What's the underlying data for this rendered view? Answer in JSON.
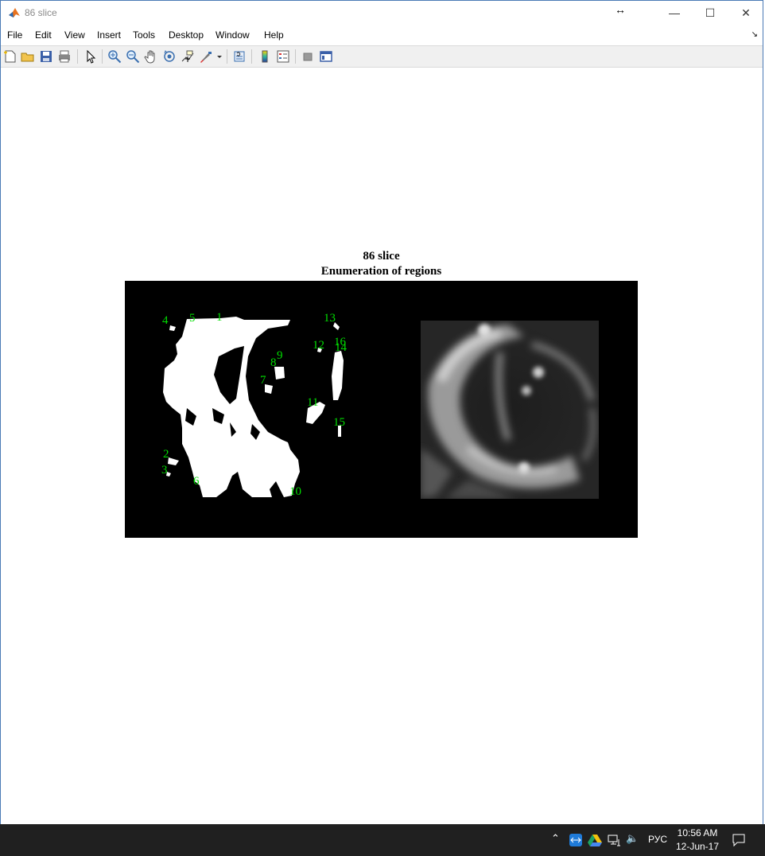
{
  "window": {
    "title": "86 slice",
    "controls": {
      "minimize": "—",
      "maximize": "☐",
      "close": "✕"
    }
  },
  "menu": [
    "File",
    "Edit",
    "View",
    "Insert",
    "Tools",
    "Desktop",
    "Window",
    "Help"
  ],
  "toolbar": {
    "icons": [
      "new-figure-icon",
      "open-file-icon",
      "save-icon",
      "print-icon",
      "select-arrow-icon",
      "zoom-in-icon",
      "zoom-out-icon",
      "pan-hand-icon",
      "rotate-3d-icon",
      "data-cursor-icon",
      "brush-icon",
      "link-plot-icon",
      "colorbar-icon",
      "legend-icon",
      "hide-plot-tools-icon",
      "show-plot-tools-icon"
    ]
  },
  "figure": {
    "title_line1": "86 slice",
    "title_line2": "Enumeration of regions",
    "label_color": "#00dd00",
    "region_labels": [
      "1",
      "2",
      "3",
      "4",
      "5",
      "6",
      "7",
      "8",
      "9",
      "10",
      "11",
      "12",
      "13",
      "14",
      "15",
      "16"
    ]
  },
  "taskbar": {
    "language": "РУС",
    "time": "10:56 AM",
    "date": "12-Jun-17"
  }
}
